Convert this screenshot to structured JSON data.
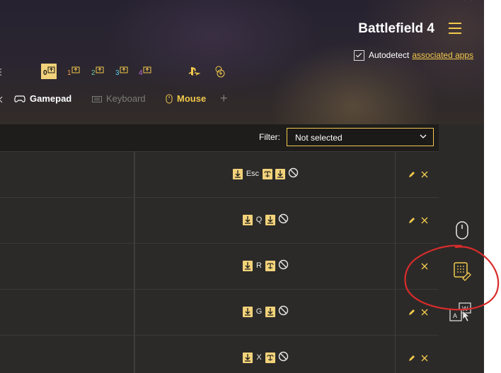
{
  "app": {
    "title": "Battlefield 4",
    "autodetect_label": "Autodetect",
    "autodetect_link": "associated apps",
    "autodetect_checked": true
  },
  "layers": [
    {
      "label": "0",
      "active": true
    },
    {
      "label": "1",
      "color": "#f2994a"
    },
    {
      "label": "2",
      "color": "#6fcf97"
    },
    {
      "label": "3",
      "color": "#56ccf2"
    },
    {
      "label": "4",
      "color": "#bb6bd9"
    }
  ],
  "tabs": {
    "gamepad": "Gamepad",
    "keyboard": "Keyboard",
    "mouse": "Mouse"
  },
  "filter": {
    "label": "Filter:",
    "value": "Not selected"
  },
  "rows": [
    {
      "key": "Esc"
    },
    {
      "key": "Q"
    },
    {
      "key": "R"
    },
    {
      "key": "G"
    },
    {
      "key": "X"
    }
  ],
  "sidebar": {
    "keymap_letters": {
      "top": "W",
      "bottom": "A"
    }
  },
  "colors": {
    "accent": "#f2c94c",
    "annotation": "#d92b2b",
    "background": "#2b2a29"
  }
}
